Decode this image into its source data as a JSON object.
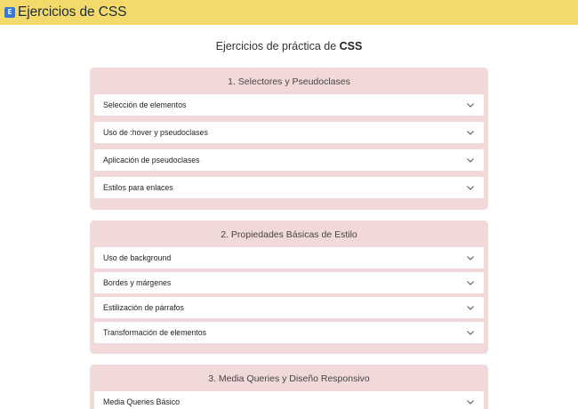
{
  "header": {
    "logo_glyph": "E",
    "title": "Ejercicios de CSS"
  },
  "page": {
    "heading_prefix": "Ejercicios de práctica de ",
    "heading_bold": "CSS"
  },
  "sections": [
    {
      "title": "1. Selectores y Pseudoclases",
      "items": [
        {
          "label": "Selección de elementos"
        },
        {
          "label": "Uso de :hover y pseudoclases"
        },
        {
          "label": "Aplicación de pseudoclases"
        },
        {
          "label": "Estilos para enlaces"
        }
      ]
    },
    {
      "title": "2. Propiedades Básicas de Estilo",
      "items": [
        {
          "label": "Uso de background"
        },
        {
          "label": "Bordes y márgenes"
        },
        {
          "label": "Estilización de párrafos"
        },
        {
          "label": "Transformación de elementos"
        }
      ]
    },
    {
      "title": "3. Media Queries y Diseño Responsivo",
      "items": [
        {
          "label": "Media Queries Básico"
        }
      ]
    }
  ],
  "colors": {
    "header_bg": "#f3da6a",
    "section_bg": "#f2d9d9",
    "logo_bg": "#3a78d8"
  },
  "icons": {
    "item_expand": "chevron-down-icon",
    "logo": "css-logo-icon"
  }
}
